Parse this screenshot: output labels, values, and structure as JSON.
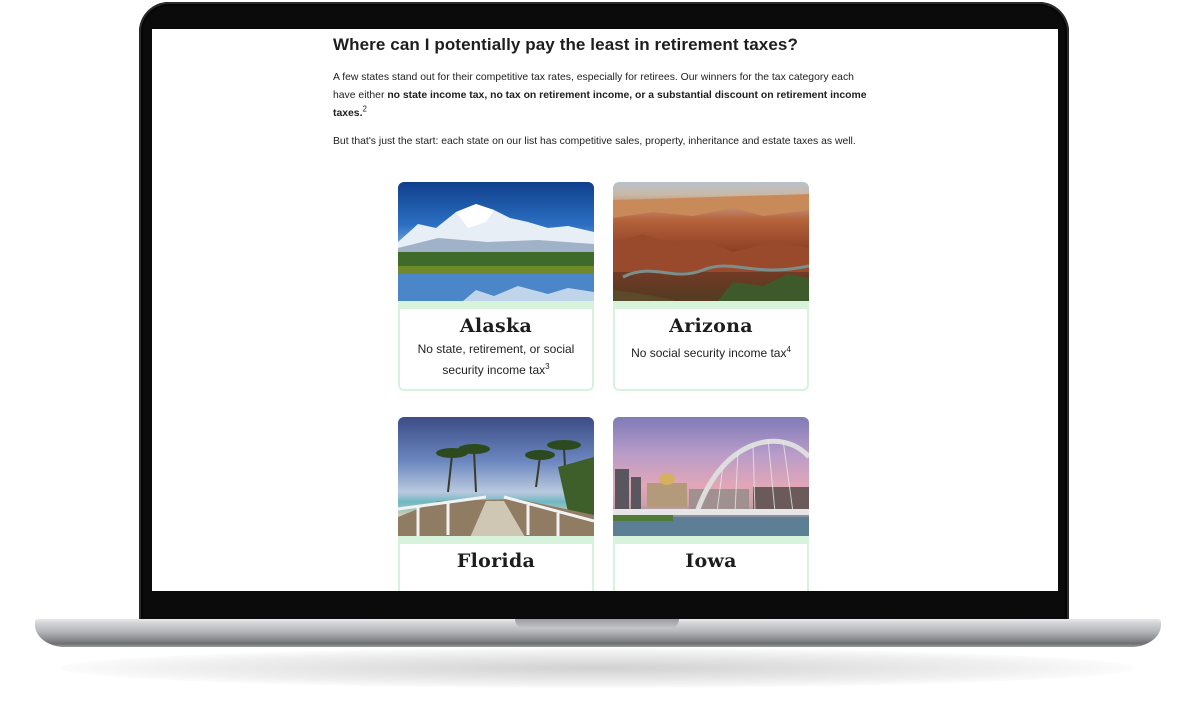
{
  "article": {
    "headline": "Where can I potentially pay the least in retirement taxes?",
    "para1_text": "A few states stand out for their competitive tax rates, especially for retirees. Our winners for the tax category each have either ",
    "para1_bold": "no state income tax, no tax on retirement income, or a substantial discount on retirement income taxes.",
    "para1_sup": "2",
    "para2": "But that's just the start: each state on our list has competitive sales, property, inheritance and estate taxes as well."
  },
  "states": [
    {
      "name": "Alaska",
      "note": "No state, retirement, or social security income tax",
      "sup": "3"
    },
    {
      "name": "Arizona",
      "note": "No social security income tax",
      "sup": "4"
    },
    {
      "name": "Florida",
      "note": "",
      "sup": ""
    },
    {
      "name": "Iowa",
      "note": "",
      "sup": ""
    }
  ],
  "colors": {
    "card_border": "#d8f3dc",
    "laptop_bezel": "#0b0b0b",
    "text": "#1e1e1e"
  }
}
